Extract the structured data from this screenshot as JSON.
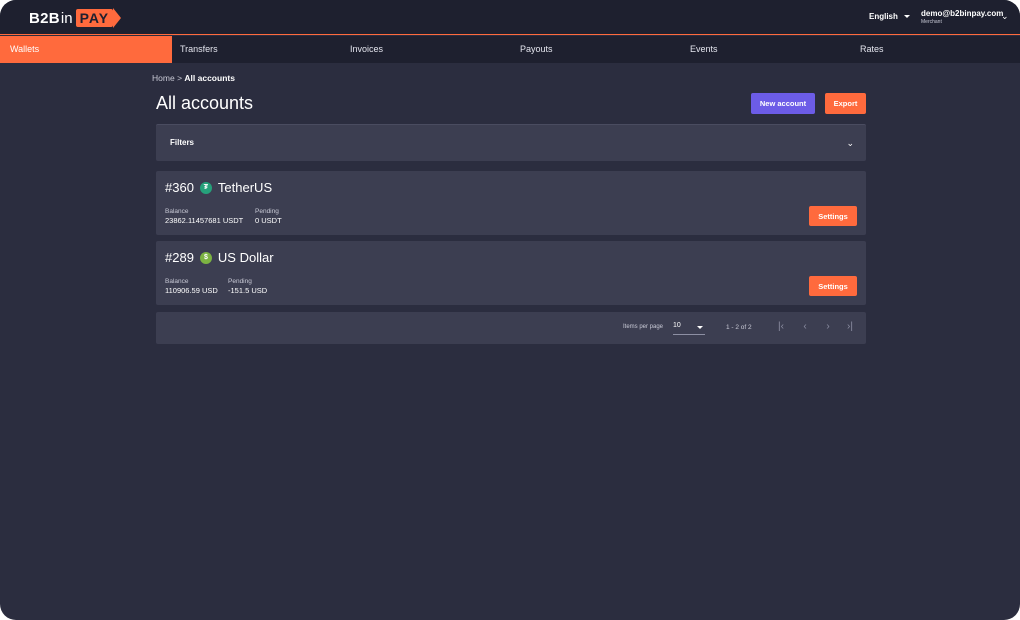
{
  "brand": {
    "part1": "B2B",
    "part2": "in",
    "part3": "PAY"
  },
  "header": {
    "language": "English",
    "user_email": "demo@b2binpay.com",
    "user_role": "Merchant"
  },
  "nav": {
    "items": [
      {
        "label": "Wallets",
        "active": true
      },
      {
        "label": "Transfers"
      },
      {
        "label": "Invoices"
      },
      {
        "label": "Payouts"
      },
      {
        "label": "Events"
      },
      {
        "label": "Rates"
      }
    ]
  },
  "breadcrumb": {
    "home": "Home",
    "separator": ">",
    "current": "All accounts"
  },
  "page": {
    "title": "All accounts",
    "new_account_label": "New account",
    "export_label": "Export"
  },
  "filters": {
    "label": "Filters"
  },
  "accounts": [
    {
      "id": "#360",
      "currency": "TetherUS",
      "icon": "tether-icon",
      "icon_glyph": "₮",
      "icon_color": "#26a17b",
      "balance_label": "Balance",
      "balance": "23862.11457681 USDT",
      "pending_label": "Pending",
      "pending": "0 USDT",
      "settings_label": "Settings"
    },
    {
      "id": "#289",
      "currency": "US Dollar",
      "icon": "dollar-icon",
      "icon_glyph": "$",
      "icon_color": "#7cb342",
      "balance_label": "Balance",
      "balance": "110906.59 USD",
      "pending_label": "Pending",
      "pending": "-151.5 USD",
      "settings_label": "Settings"
    }
  ],
  "pagination": {
    "items_per_page_label": "Items per page",
    "items_per_page": "10",
    "range": "1 - 2 of 2"
  },
  "colors": {
    "accent": "#ff6a3d",
    "primary": "#6c5ce7",
    "background": "#2b2d3f",
    "panel": "#3c3e51",
    "topbar": "#1e202f"
  }
}
